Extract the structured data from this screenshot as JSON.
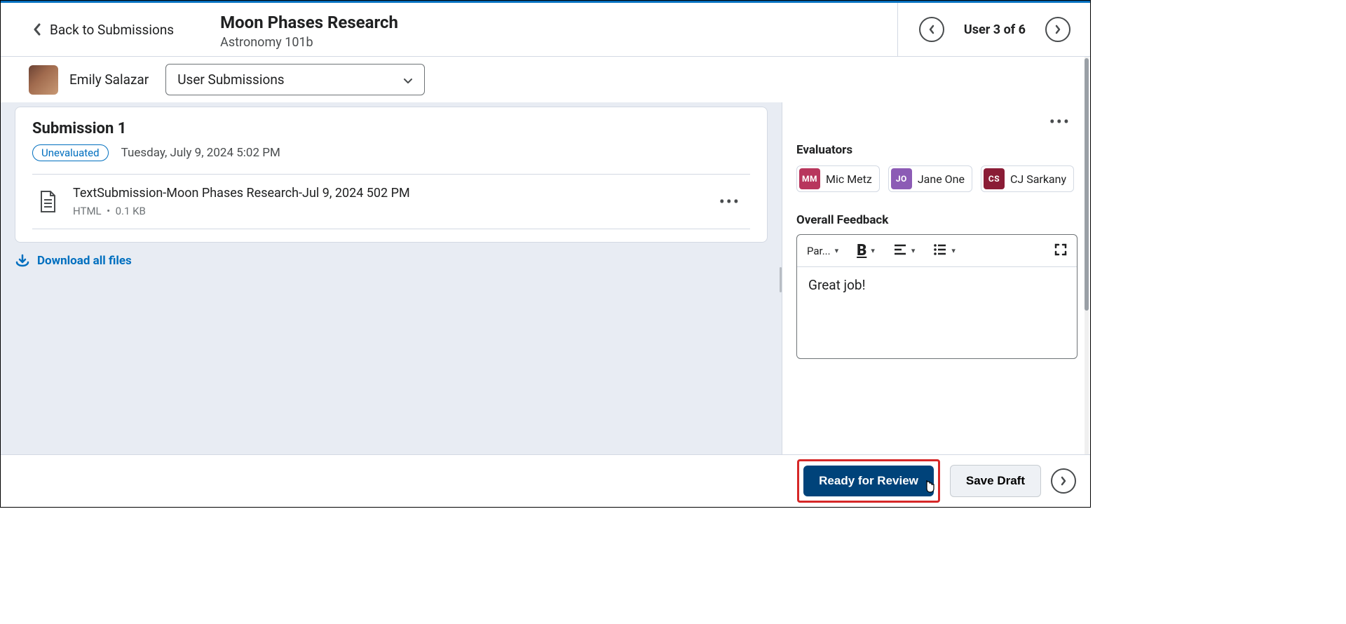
{
  "header": {
    "back_label": "Back to Submissions",
    "title": "Moon Phases Research",
    "subtitle": "Astronomy 101b",
    "user_nav": "User 3 of 6"
  },
  "subheader": {
    "student_name": "Emily Salazar",
    "dropdown": "User Submissions"
  },
  "submission": {
    "title": "Submission 1",
    "badge": "Unevaluated",
    "datetime": "Tuesday, July 9, 2024 5:02 PM",
    "file_name": "TextSubmission-Moon Phases Research-Jul 9, 2024 502 PM",
    "file_type": "HTML",
    "file_dot": "•",
    "file_size": "0.1 KB",
    "download": "Download all files"
  },
  "sidebar": {
    "evaluators_label": "Evaluators",
    "evaluators": [
      {
        "initials": "MM",
        "name": "Mic Metz",
        "color": "c1"
      },
      {
        "initials": "JO",
        "name": "Jane One",
        "color": "c2"
      },
      {
        "initials": "CS",
        "name": "CJ Sarkany",
        "color": "c3"
      }
    ],
    "feedback_label": "Overall Feedback",
    "toolbar_para": "Par...",
    "feedback_text": "Great job!"
  },
  "footer": {
    "primary": "Ready for Review",
    "secondary": "Save Draft"
  }
}
